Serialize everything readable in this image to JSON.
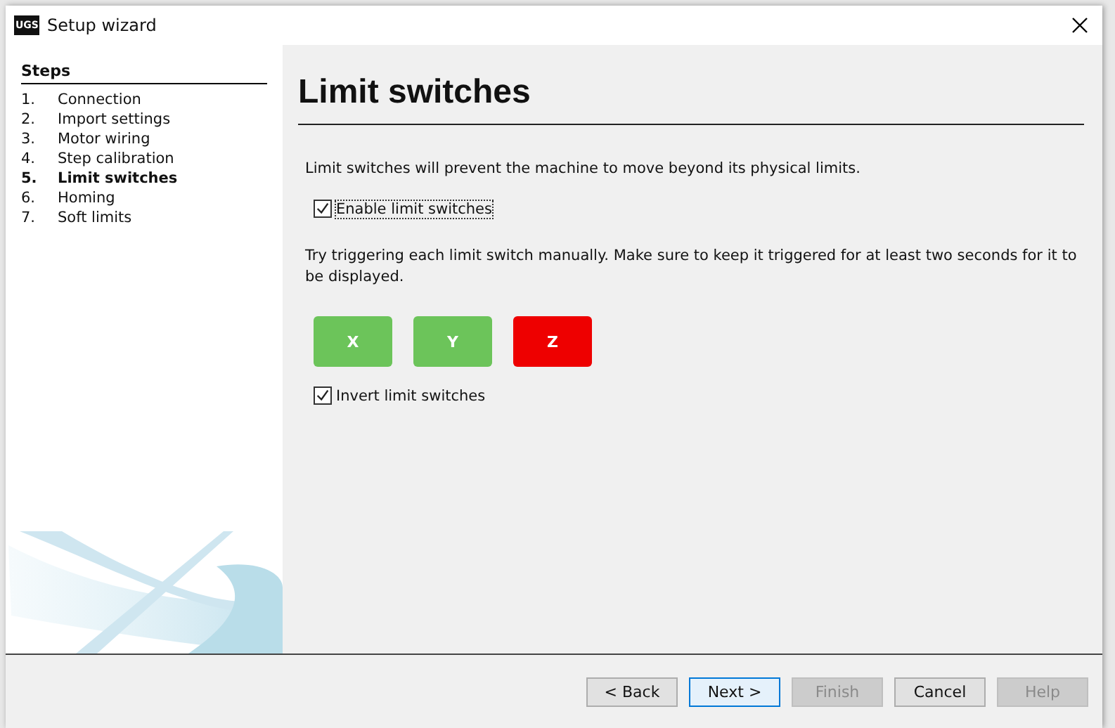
{
  "window": {
    "title": "Setup wizard",
    "logo": "UGS"
  },
  "steps": {
    "heading": "Steps",
    "items": [
      {
        "number": "1.",
        "label": "Connection",
        "selected": false
      },
      {
        "number": "2.",
        "label": "Import settings",
        "selected": false
      },
      {
        "number": "3.",
        "label": "Motor wiring",
        "selected": false
      },
      {
        "number": "4.",
        "label": "Step calibration",
        "selected": false
      },
      {
        "number": "5.",
        "label": "Limit switches",
        "selected": true
      },
      {
        "number": "6.",
        "label": "Homing",
        "selected": false
      },
      {
        "number": "7.",
        "label": "Soft limits",
        "selected": false
      }
    ]
  },
  "page": {
    "title": "Limit switches",
    "intro": "Limit switches will prevent the machine to move beyond its physical limits.",
    "enable": {
      "label": "Enable limit switches",
      "checked": true
    },
    "instructions": "Try triggering each limit switch manually. Make sure to keep it triggered for at least two seconds for it to be displayed.",
    "switches": [
      {
        "label": "X",
        "color": "#6cc45a"
      },
      {
        "label": "Y",
        "color": "#6cc45a"
      },
      {
        "label": "Z",
        "color": "#ee0000"
      }
    ],
    "invert": {
      "label": "Invert limit switches",
      "checked": true
    }
  },
  "buttons": [
    {
      "label": "< Back",
      "disabled": false,
      "default": false
    },
    {
      "label": "Next >",
      "disabled": false,
      "default": true
    },
    {
      "label": "Finish",
      "disabled": true,
      "default": false
    },
    {
      "label": "Cancel",
      "disabled": false,
      "default": false
    },
    {
      "label": "Help",
      "disabled": true,
      "default": false
    }
  ]
}
